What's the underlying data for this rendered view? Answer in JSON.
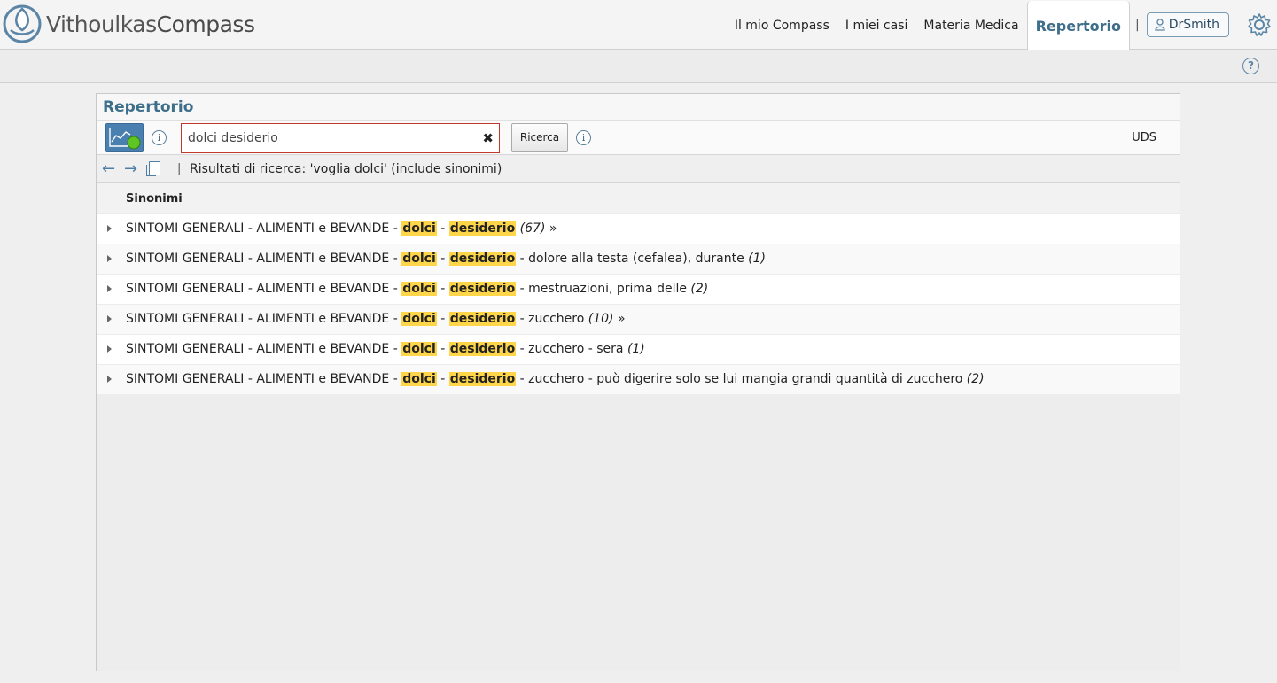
{
  "app": {
    "logo_part1": "Vithoulkas",
    "logo_part2": "Compass"
  },
  "nav": {
    "items": [
      "Il mio Compass",
      "I miei casi",
      "Materia Medica",
      "Repertorio"
    ],
    "active": "Repertorio",
    "separator": "|",
    "user": "DrSmith"
  },
  "subbar": {
    "help": "?"
  },
  "panel": {
    "title": "Repertorio",
    "search": {
      "value": "dolci desiderio",
      "button": "Ricerca",
      "clear": "✖"
    },
    "uds": "UDS",
    "results_sep": "|",
    "results_label": "Risultati di ricerca: 'voglia dolci' (include sinonimi)",
    "column_header": "Sinonimi",
    "rows": [
      {
        "prefix": "SINTOMI GENERALI - ALIMENTI e BEVANDE - ",
        "h1": "dolci",
        "mid": " - ",
        "h2": "desiderio",
        "suffix": " ",
        "count": "(67)",
        "more": " »"
      },
      {
        "prefix": "SINTOMI GENERALI - ALIMENTI e BEVANDE - ",
        "h1": "dolci",
        "mid": " - ",
        "h2": "desiderio",
        "suffix": " - dolore alla testa (cefalea), durante ",
        "count": "(1)",
        "more": ""
      },
      {
        "prefix": "SINTOMI GENERALI - ALIMENTI e BEVANDE - ",
        "h1": "dolci",
        "mid": " - ",
        "h2": "desiderio",
        "suffix": " - mestruazioni, prima delle ",
        "count": "(2)",
        "more": ""
      },
      {
        "prefix": "SINTOMI GENERALI - ALIMENTI e BEVANDE - ",
        "h1": "dolci",
        "mid": " - ",
        "h2": "desiderio",
        "suffix": " - zucchero ",
        "count": "(10)",
        "more": " »"
      },
      {
        "prefix": "SINTOMI GENERALI - ALIMENTI e BEVANDE - ",
        "h1": "dolci",
        "mid": " - ",
        "h2": "desiderio",
        "suffix": " - zucchero - sera ",
        "count": "(1)",
        "more": ""
      },
      {
        "prefix": "SINTOMI GENERALI - ALIMENTI e BEVANDE - ",
        "h1": "dolci",
        "mid": " - ",
        "h2": "desiderio",
        "suffix": " - zucchero - può digerire solo se lui mangia grandi quantità di zucchero ",
        "count": "(2)",
        "more": ""
      }
    ]
  },
  "colors": {
    "accent": "#3d6e8a",
    "highlight": "#ffd54a",
    "search_border": "#c0392b"
  },
  "icons": [
    "compass-logo-icon",
    "user-icon",
    "gear-icon",
    "help-icon",
    "chart-icon",
    "info-icon",
    "clear-icon",
    "back-arrow-icon",
    "forward-arrow-icon",
    "copy-icon",
    "expand-triangle-icon"
  ]
}
